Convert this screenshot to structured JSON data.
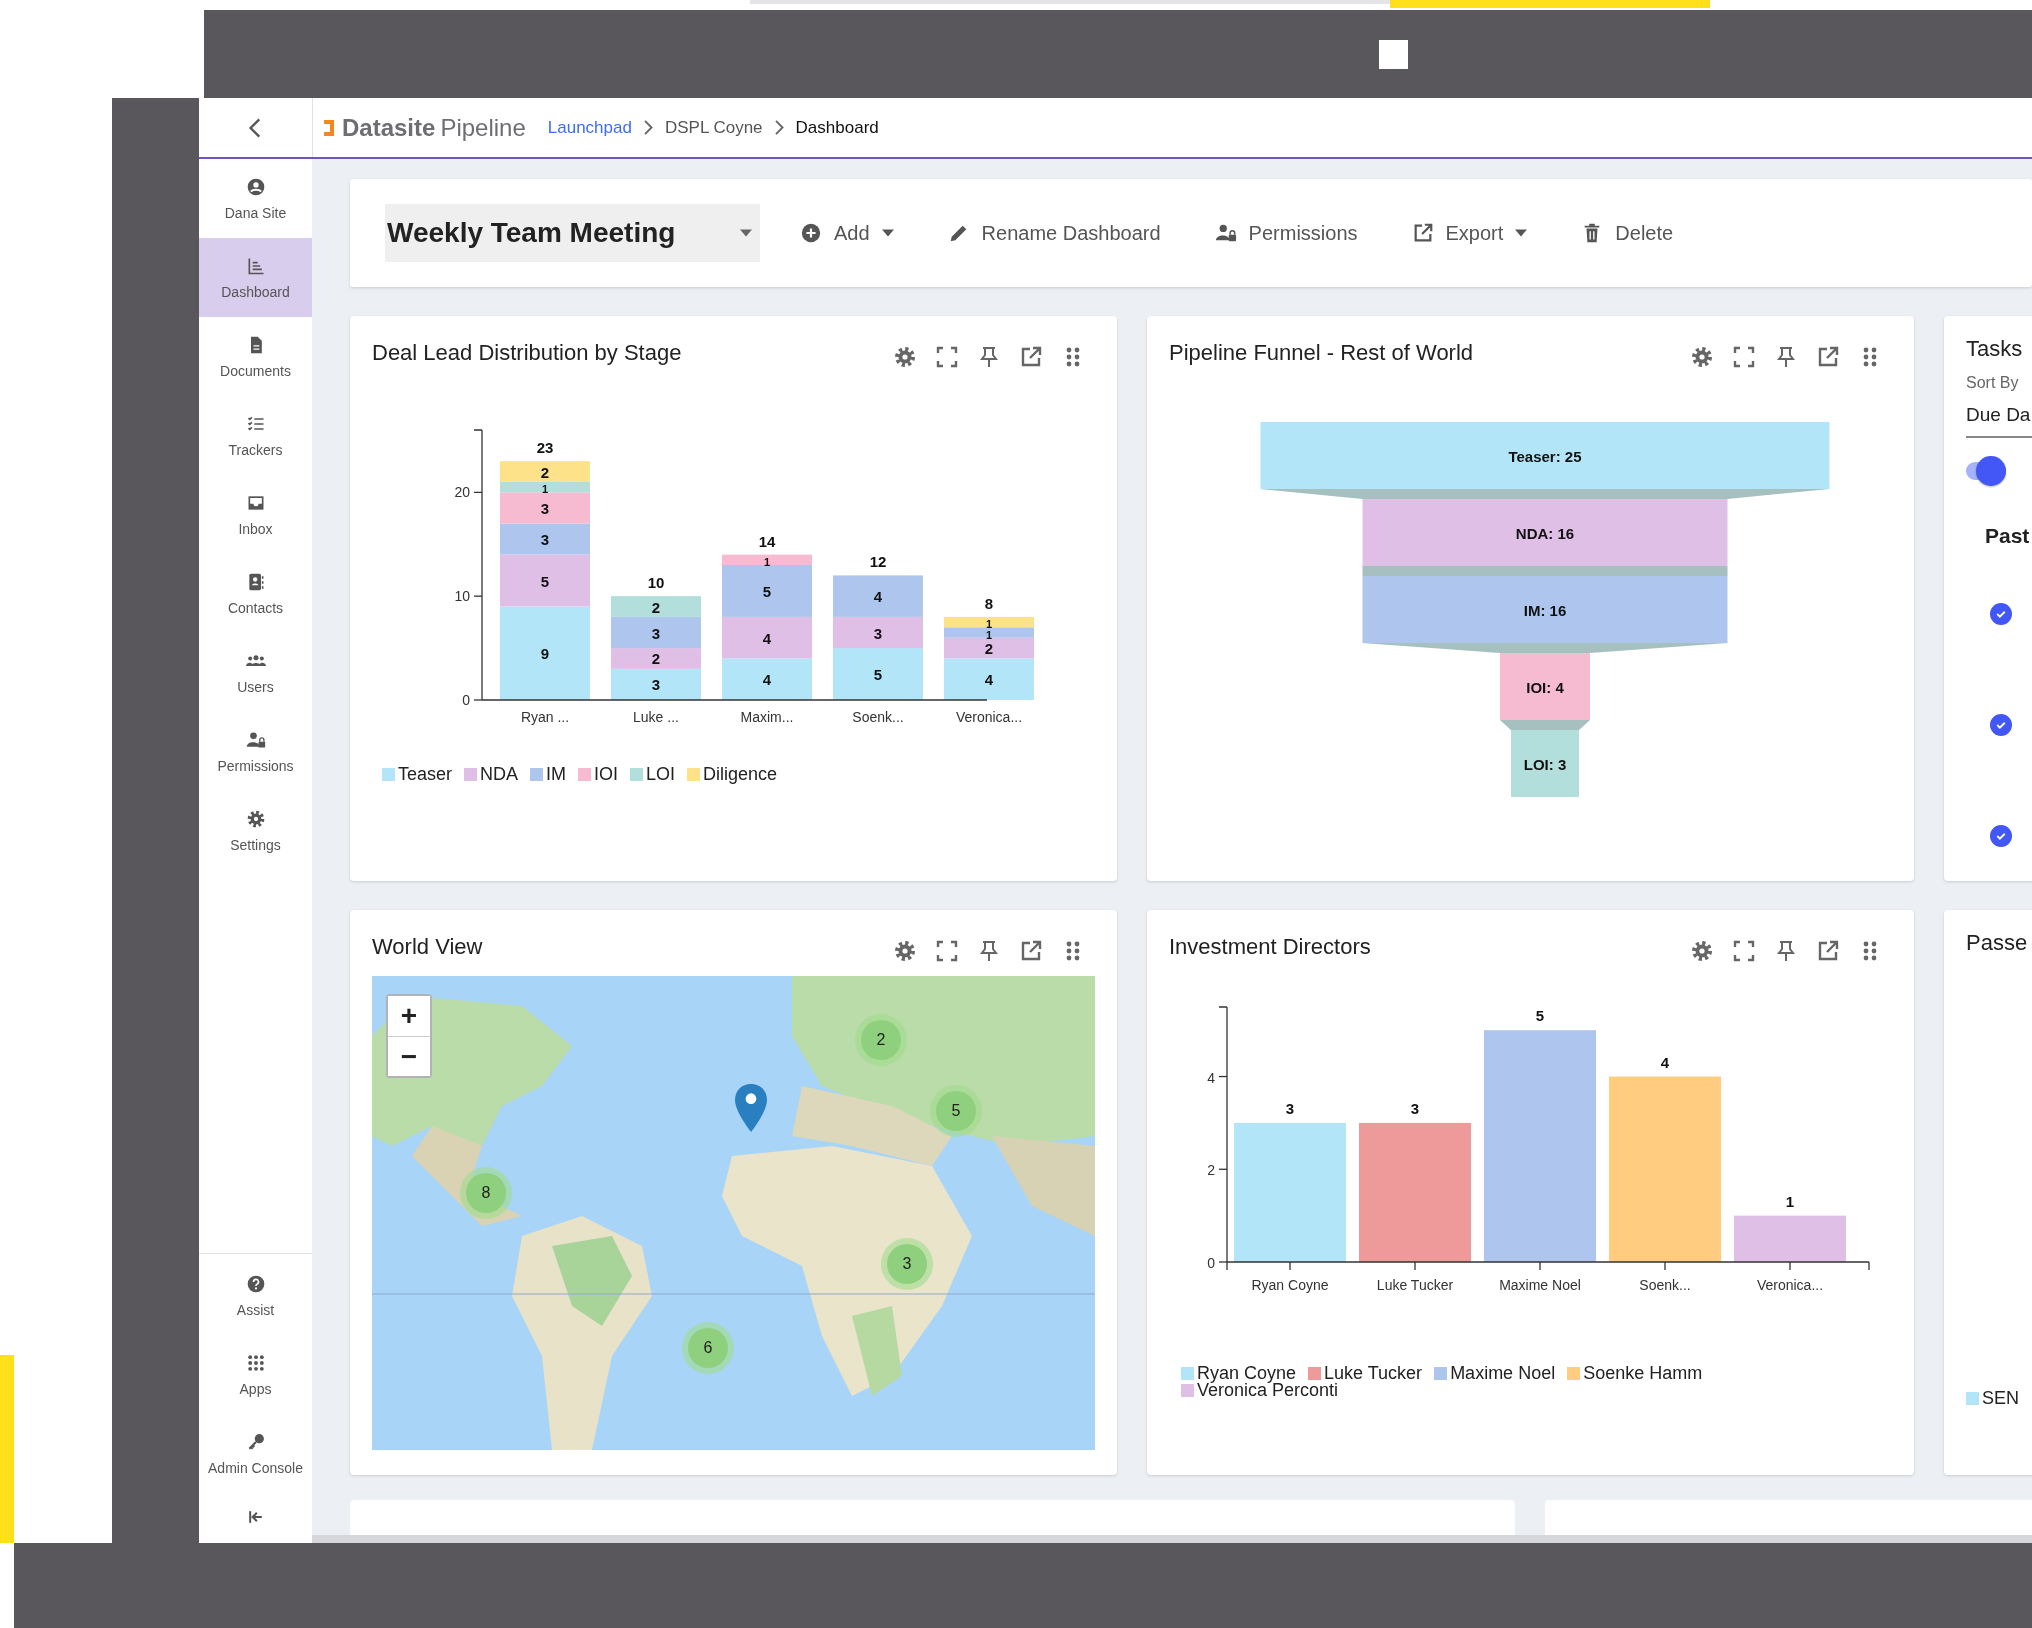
{
  "header": {
    "logo_main": "Datasite",
    "logo_sub": "Pipeline",
    "breadcrumb": [
      {
        "label": "Launchpad",
        "link": true
      },
      {
        "label": "DSPL Coyne",
        "link": false
      },
      {
        "label": "Dashboard",
        "link": false
      }
    ]
  },
  "sidebar": {
    "items": [
      {
        "label": "Dana Site",
        "selected": false
      },
      {
        "label": "Dashboard",
        "selected": true
      },
      {
        "label": "Documents",
        "selected": false
      },
      {
        "label": "Trackers",
        "selected": false
      },
      {
        "label": "Inbox",
        "selected": false
      },
      {
        "label": "Contacts",
        "selected": false
      },
      {
        "label": "Users",
        "selected": false
      },
      {
        "label": "Permissions",
        "selected": false
      },
      {
        "label": "Settings",
        "selected": false
      }
    ],
    "bottom_items": [
      {
        "label": "Assist"
      },
      {
        "label": "Apps"
      },
      {
        "label": "Admin Console"
      }
    ]
  },
  "toolbar": {
    "dashboard": "Weekly Team Meeting",
    "actions": [
      {
        "label": "Add",
        "dropdown": true
      },
      {
        "label": "Rename Dashboard",
        "dropdown": false
      },
      {
        "label": "Permissions",
        "dropdown": false
      },
      {
        "label": "Export",
        "dropdown": true
      },
      {
        "label": "Delete",
        "dropdown": false
      }
    ]
  },
  "deal_chart": {
    "title": "Deal Lead Distribution by Stage",
    "chart_data": {
      "type": "bar",
      "stacked": true,
      "categories": [
        "Ryan ...",
        "Luke ...",
        "Maxim...",
        "Soenk...",
        "Veronica..."
      ],
      "ylim": [
        0,
        26
      ],
      "yticks": [
        0,
        10,
        20
      ],
      "data_labels": true,
      "annotations": [
        "23",
        "10",
        "14",
        "12",
        "8"
      ],
      "series": [
        {
          "name": "Teaser",
          "color": "#b3e5f8",
          "values": [
            9,
            3,
            4,
            5,
            4
          ]
        },
        {
          "name": "NDA",
          "color": "#e0bfe7",
          "values": [
            5,
            2,
            4,
            3,
            2
          ]
        },
        {
          "name": "IM",
          "color": "#aec6ee",
          "values": [
            3,
            3,
            5,
            4,
            1
          ]
        },
        {
          "name": "IOI",
          "color": "#f6bbd0",
          "values": [
            3,
            null,
            1,
            null,
            null
          ]
        },
        {
          "name": "LOI",
          "color": "#b2dfdb",
          "values": [
            1,
            2,
            null,
            null,
            null
          ]
        },
        {
          "name": "Diligence",
          "color": "#fde28a",
          "values": [
            2,
            null,
            null,
            null,
            1
          ]
        }
      ]
    }
  },
  "funnel": {
    "title": "Pipeline Funnel - Rest of World",
    "stages": [
      {
        "label": "Teaser: 25",
        "color": "#b3e5f8"
      },
      {
        "label": "NDA: 16",
        "color": "#e0bfe7"
      },
      {
        "label": "IM: 16",
        "color": "#aec6ee"
      },
      {
        "label": "IOI: 4",
        "color": "#f6bbd0"
      },
      {
        "label": "LOI: 3",
        "color": "#b2dfdb"
      }
    ]
  },
  "tasks": {
    "title": "Tasks",
    "sort_label": "Sort By",
    "sort_value": "Due Da",
    "toggle_on": true,
    "section": "Past",
    "items": [
      {
        "checked": true
      },
      {
        "checked": true
      },
      {
        "checked": true
      }
    ]
  },
  "world_view": {
    "title": "World View",
    "zoom_in": "+",
    "zoom_out": "−",
    "clusters": [
      "2",
      "5",
      "8",
      "3",
      "6"
    ]
  },
  "directors": {
    "title": "Investment Directors",
    "chart_data": {
      "type": "bar",
      "stacked": true,
      "categories": [
        "Ryan Coyne",
        "Luke Tucker",
        "Maxime Noel",
        "Soenk...",
        "Veronica..."
      ],
      "ylim": [
        0,
        5.5
      ],
      "yticks": [
        0,
        2,
        4
      ],
      "data_labels": true,
      "series": [
        {
          "name": "Ryan Coyne",
          "color": "#b3e5f8",
          "values": [
            3,
            null,
            null,
            null,
            null
          ]
        },
        {
          "name": "Luke Tucker",
          "color": "#ef9a9a",
          "values": [
            null,
            3,
            null,
            null,
            null
          ]
        },
        {
          "name": "Maxime Noel",
          "color": "#aec6ee",
          "values": [
            null,
            null,
            5,
            null,
            null
          ]
        },
        {
          "name": "Soenke Hamm",
          "color": "#ffcc80",
          "values": [
            null,
            null,
            null,
            4,
            null
          ]
        },
        {
          "name": "Veronica Perconti",
          "color": "#e0bfe7",
          "values": [
            null,
            null,
            null,
            null,
            1
          ]
        }
      ]
    }
  },
  "passed": {
    "title": "Passe",
    "legend": [
      {
        "label": "SEN",
        "color": "#b3e5f8"
      }
    ]
  }
}
